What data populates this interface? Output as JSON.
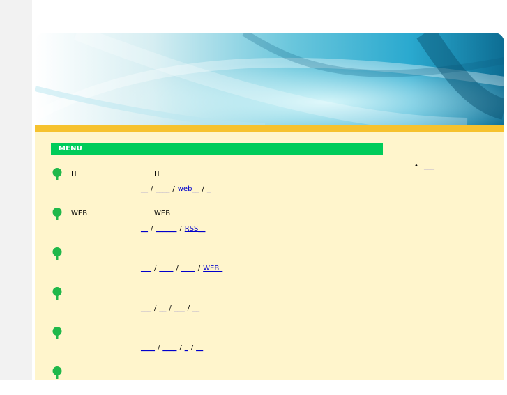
{
  "colors": {
    "menu_bar": "#00cc5a",
    "yellow_strip": "#f6c22e",
    "content_bg": "#fff5cc",
    "link": "#0000cc",
    "tree_icon": "#1fb84a"
  },
  "menu": {
    "title": "MENU",
    "items": [
      {
        "name": "IT",
        "desc": "IT",
        "links": [
          "__",
          "____",
          "web__",
          "_"
        ]
      },
      {
        "name": "WEB",
        "desc": "WEB",
        "links": [
          "__",
          "______",
          "RSS__"
        ]
      },
      {
        "name": "",
        "desc": "",
        "links": [
          "___",
          "____",
          "____",
          "WEB_"
        ]
      },
      {
        "name": "",
        "desc": "",
        "links": [
          "___",
          "__",
          "___",
          "__"
        ]
      },
      {
        "name": "",
        "desc": "",
        "links": [
          "____",
          "____",
          "_",
          "__"
        ]
      },
      {
        "name": "",
        "desc": "",
        "links": []
      }
    ]
  },
  "sidebar": {
    "bullet": "•",
    "links": [
      "___"
    ]
  },
  "icons": {
    "menu_item_icon": "tree-icon"
  }
}
